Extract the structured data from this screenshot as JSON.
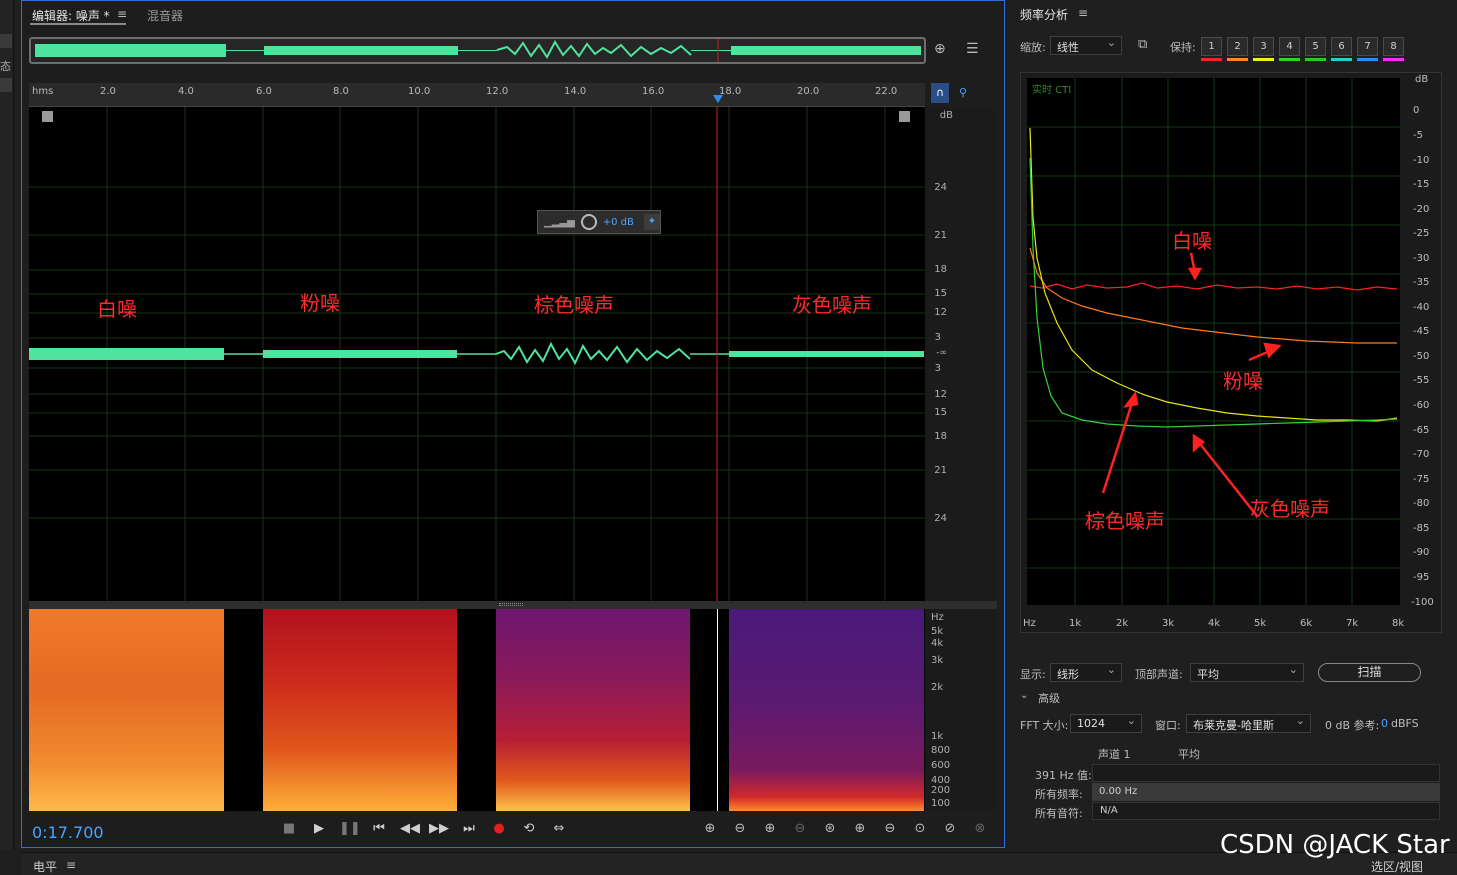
{
  "left_strip": {
    "glyph": "态"
  },
  "editor": {
    "tab_active": "编辑器: 噪声 *",
    "tab_menu": "≡",
    "tab_mixer": "混音器",
    "ruler_unit": "hms",
    "ruler_ticks": [
      "2.0",
      "4.0",
      "6.0",
      "8.0",
      "10.0",
      "12.0",
      "14.0",
      "16.0",
      "18.0",
      "20.0",
      "22.0"
    ],
    "db_unit": "dB",
    "db_ticks": [
      "24",
      "21",
      "18",
      "15",
      "12",
      "3",
      "-∞",
      "3",
      "12",
      "15",
      "18",
      "21",
      "24"
    ],
    "hz_ticks": [
      "Hz",
      "5k",
      "4k",
      "3k",
      "2k",
      "1k",
      "800",
      "600",
      "400",
      "200",
      "100"
    ],
    "noise_labels": [
      "白噪",
      "粉噪",
      "棕色噪声",
      "灰色噪声"
    ],
    "volume_hud": "+0 dB",
    "playhead_seconds": 17.7,
    "current_time": "0:17.700",
    "accent_color": "#4aa3ff",
    "waveform_color": "#4fe3a0"
  },
  "frequency": {
    "title": "频率分析",
    "title_menu": "≡",
    "scale_label": "缩放:",
    "scale_value": "线性",
    "hold_label": "保持:",
    "hold_buttons": [
      "1",
      "2",
      "3",
      "4",
      "5",
      "6",
      "7",
      "8"
    ],
    "hold_colors": [
      "#ff2020",
      "#ff8a1a",
      "#f2f21a",
      "#2ad52a",
      "#26c926",
      "#1ad2d2",
      "#2a8aff",
      "#ff2aff"
    ],
    "realtime_label": "实时 CTI",
    "db_unit": "dB",
    "db_ticks": [
      "0",
      "-5",
      "-10",
      "-15",
      "-20",
      "-25",
      "-30",
      "-35",
      "-40",
      "-45",
      "-50",
      "-55",
      "-60",
      "-65",
      "-70",
      "-75",
      "-80",
      "-85",
      "-90",
      "-95",
      "-100"
    ],
    "hz_ticks": [
      "Hz",
      "1k",
      "2k",
      "3k",
      "4k",
      "5k",
      "6k",
      "7k",
      "8k"
    ],
    "annotations": [
      "白噪",
      "粉噪",
      "棕色噪声",
      "灰色噪声"
    ],
    "display_label": "显示:",
    "display_value": "线形",
    "top_channel_label": "顶部声道:",
    "top_channel_value": "平均",
    "scan_button": "扫描",
    "advanced": "高级",
    "fft_label": "FFT 大小:",
    "fft_value": "1024",
    "window_label": "窗口:",
    "window_value": "布莱克曼-哈里斯",
    "db_ref_label": "0 dB 参考:",
    "db_ref_value": "0",
    "db_ref_unit": "dBFS",
    "col_channel": "声道 1",
    "col_average": "平均",
    "row_hz_label": "391 Hz 值:",
    "row_all_freq_label": "所有频率:",
    "row_all_freq_value": "0.00 Hz",
    "row_all_notes_label": "所有音符:",
    "row_all_notes_value": "N/A"
  },
  "bottom": {
    "level_label": "电平",
    "level_menu": "≡",
    "selection_label": "选区/视图"
  },
  "watermark": "CSDN @JACK Star"
}
